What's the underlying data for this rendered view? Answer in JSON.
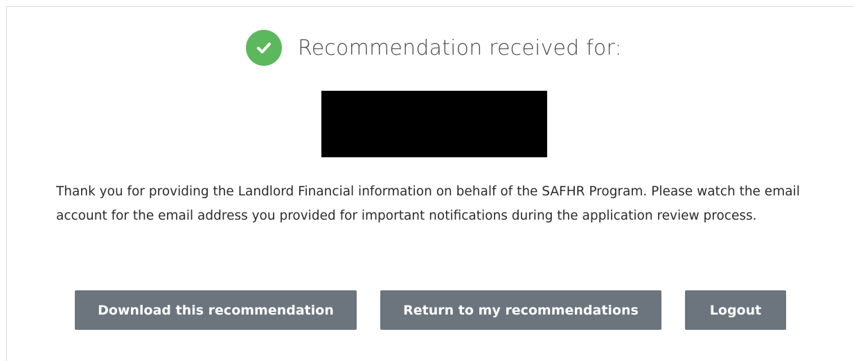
{
  "confirmation": {
    "title": "Recommendation received for:",
    "message": "Thank you for providing the Landlord Financial information on behalf of the SAFHR Program. Please watch the email account for the email address you provided for important notifications during the application review process."
  },
  "actions": {
    "download_label": "Download this recommendation",
    "return_label": "Return to my recommendations",
    "logout_label": "Logout"
  },
  "icons": {
    "status": "check-circle-icon"
  },
  "colors": {
    "success": "#5cb85c",
    "button_bg": "#6c757d",
    "redaction": "#000000"
  }
}
